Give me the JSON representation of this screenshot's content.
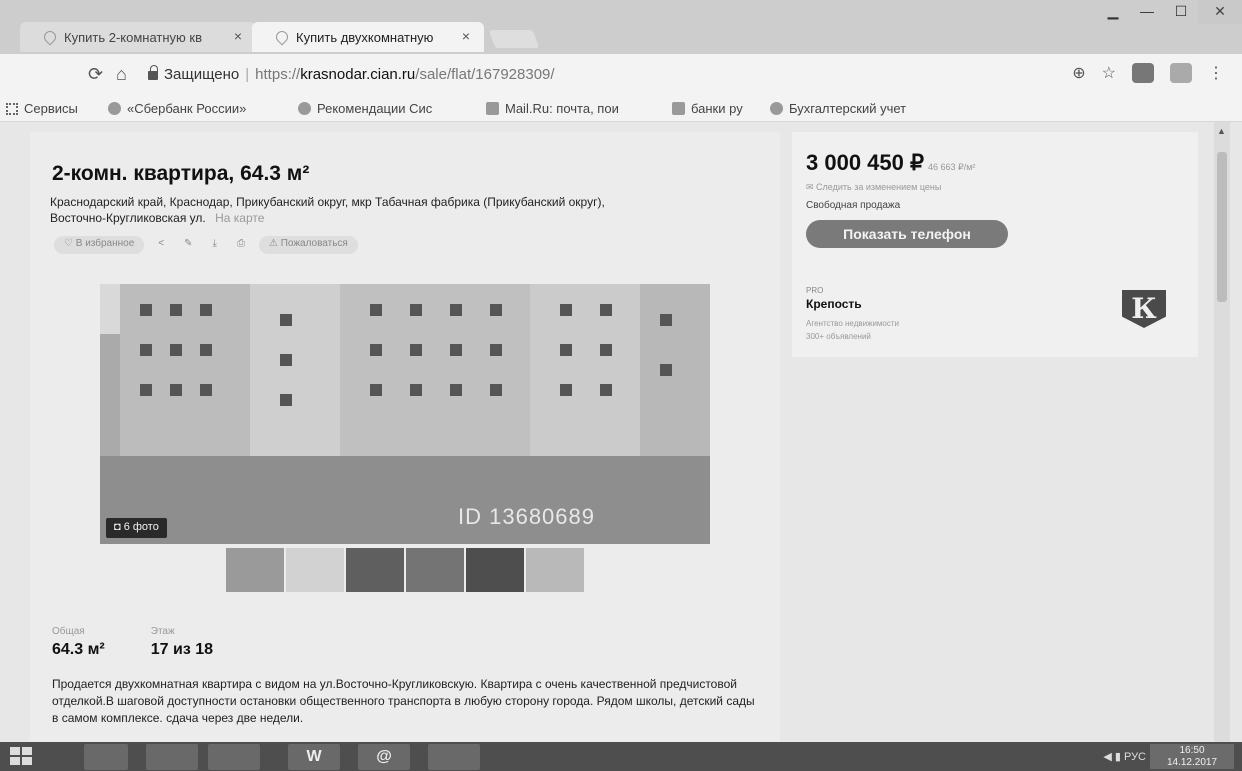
{
  "browser": {
    "tabs": [
      {
        "title": "Купить 2-комнатную кв",
        "active": false
      },
      {
        "title": "Купить двухкомнатную",
        "active": true
      }
    ],
    "tab_close": "×",
    "window_buttons": [
      "▁",
      "—",
      "☐",
      "✕"
    ],
    "security_label": "Защищено",
    "url": {
      "scheme": "https://",
      "host": "krasnodar.cian.ru",
      "path": "/sale/flat/167928309/"
    },
    "bookmarks": [
      "Сервисы",
      "«Сбербанк России»",
      "Рекомендации Сис",
      "Mail.Ru: почта, пои",
      "банки ру",
      "Бухгалтерский учет"
    ]
  },
  "listing": {
    "title": "2-комн. квартира, 64.3 м²",
    "address": "Краснодарский край, Краснодар, Прикубанский округ, мкр Табачная фабрика (Прикубанский округ), Восточно-Кругликовская ул.",
    "map_link": "На карте",
    "favorite_label": "В избранное",
    "complain_label": "Пожаловаться",
    "photo_count_label": "6 фото",
    "watermark": "ID 13680689",
    "stats": [
      {
        "label": "Общая",
        "value": "64.3 м²"
      },
      {
        "label": "Этаж",
        "value": "17 из 18"
      }
    ],
    "description": "Продается двухкомнатная квартира с видом на  ул.Восточно-Кругликовскую. Квартира с очень качественной предчистовой отделкой.В шаговой доступности остановки общественного транспорта в любую сторону города. Рядом школы, детский сады в самом комплексе. сдача через две недели."
  },
  "sidebar": {
    "price": "3 000 450 ₽",
    "price_per_m2": "46 663 ₽/м²",
    "follow_price": "Следить за изменением цены",
    "sale_type": "Свободная продажа",
    "phone_button": "Показать телефон",
    "agency_tag": "PRO",
    "agency_name": "Крепость",
    "agency_type": "Агентство недвижимости",
    "agency_count": "300+ объявлений",
    "agency_logo_letter": "К"
  },
  "taskbar": {
    "apps": [
      "",
      "",
      "",
      "W",
      "@",
      ""
    ],
    "lang": "РУС",
    "time": "16:50",
    "date": "14.12.2017"
  }
}
